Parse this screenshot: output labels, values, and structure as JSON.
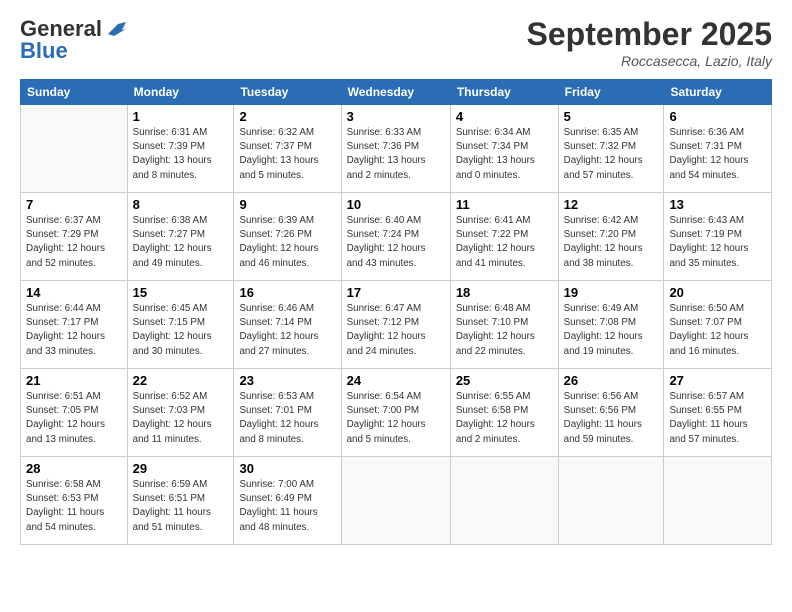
{
  "header": {
    "logo_line1": "General",
    "logo_line2": "Blue",
    "month": "September 2025",
    "location": "Roccasecca, Lazio, Italy"
  },
  "weekdays": [
    "Sunday",
    "Monday",
    "Tuesday",
    "Wednesday",
    "Thursday",
    "Friday",
    "Saturday"
  ],
  "weeks": [
    [
      {
        "day": "",
        "info": ""
      },
      {
        "day": "1",
        "info": "Sunrise: 6:31 AM\nSunset: 7:39 PM\nDaylight: 13 hours\nand 8 minutes."
      },
      {
        "day": "2",
        "info": "Sunrise: 6:32 AM\nSunset: 7:37 PM\nDaylight: 13 hours\nand 5 minutes."
      },
      {
        "day": "3",
        "info": "Sunrise: 6:33 AM\nSunset: 7:36 PM\nDaylight: 13 hours\nand 2 minutes."
      },
      {
        "day": "4",
        "info": "Sunrise: 6:34 AM\nSunset: 7:34 PM\nDaylight: 13 hours\nand 0 minutes."
      },
      {
        "day": "5",
        "info": "Sunrise: 6:35 AM\nSunset: 7:32 PM\nDaylight: 12 hours\nand 57 minutes."
      },
      {
        "day": "6",
        "info": "Sunrise: 6:36 AM\nSunset: 7:31 PM\nDaylight: 12 hours\nand 54 minutes."
      }
    ],
    [
      {
        "day": "7",
        "info": "Sunrise: 6:37 AM\nSunset: 7:29 PM\nDaylight: 12 hours\nand 52 minutes."
      },
      {
        "day": "8",
        "info": "Sunrise: 6:38 AM\nSunset: 7:27 PM\nDaylight: 12 hours\nand 49 minutes."
      },
      {
        "day": "9",
        "info": "Sunrise: 6:39 AM\nSunset: 7:26 PM\nDaylight: 12 hours\nand 46 minutes."
      },
      {
        "day": "10",
        "info": "Sunrise: 6:40 AM\nSunset: 7:24 PM\nDaylight: 12 hours\nand 43 minutes."
      },
      {
        "day": "11",
        "info": "Sunrise: 6:41 AM\nSunset: 7:22 PM\nDaylight: 12 hours\nand 41 minutes."
      },
      {
        "day": "12",
        "info": "Sunrise: 6:42 AM\nSunset: 7:20 PM\nDaylight: 12 hours\nand 38 minutes."
      },
      {
        "day": "13",
        "info": "Sunrise: 6:43 AM\nSunset: 7:19 PM\nDaylight: 12 hours\nand 35 minutes."
      }
    ],
    [
      {
        "day": "14",
        "info": "Sunrise: 6:44 AM\nSunset: 7:17 PM\nDaylight: 12 hours\nand 33 minutes."
      },
      {
        "day": "15",
        "info": "Sunrise: 6:45 AM\nSunset: 7:15 PM\nDaylight: 12 hours\nand 30 minutes."
      },
      {
        "day": "16",
        "info": "Sunrise: 6:46 AM\nSunset: 7:14 PM\nDaylight: 12 hours\nand 27 minutes."
      },
      {
        "day": "17",
        "info": "Sunrise: 6:47 AM\nSunset: 7:12 PM\nDaylight: 12 hours\nand 24 minutes."
      },
      {
        "day": "18",
        "info": "Sunrise: 6:48 AM\nSunset: 7:10 PM\nDaylight: 12 hours\nand 22 minutes."
      },
      {
        "day": "19",
        "info": "Sunrise: 6:49 AM\nSunset: 7:08 PM\nDaylight: 12 hours\nand 19 minutes."
      },
      {
        "day": "20",
        "info": "Sunrise: 6:50 AM\nSunset: 7:07 PM\nDaylight: 12 hours\nand 16 minutes."
      }
    ],
    [
      {
        "day": "21",
        "info": "Sunrise: 6:51 AM\nSunset: 7:05 PM\nDaylight: 12 hours\nand 13 minutes."
      },
      {
        "day": "22",
        "info": "Sunrise: 6:52 AM\nSunset: 7:03 PM\nDaylight: 12 hours\nand 11 minutes."
      },
      {
        "day": "23",
        "info": "Sunrise: 6:53 AM\nSunset: 7:01 PM\nDaylight: 12 hours\nand 8 minutes."
      },
      {
        "day": "24",
        "info": "Sunrise: 6:54 AM\nSunset: 7:00 PM\nDaylight: 12 hours\nand 5 minutes."
      },
      {
        "day": "25",
        "info": "Sunrise: 6:55 AM\nSunset: 6:58 PM\nDaylight: 12 hours\nand 2 minutes."
      },
      {
        "day": "26",
        "info": "Sunrise: 6:56 AM\nSunset: 6:56 PM\nDaylight: 11 hours\nand 59 minutes."
      },
      {
        "day": "27",
        "info": "Sunrise: 6:57 AM\nSunset: 6:55 PM\nDaylight: 11 hours\nand 57 minutes."
      }
    ],
    [
      {
        "day": "28",
        "info": "Sunrise: 6:58 AM\nSunset: 6:53 PM\nDaylight: 11 hours\nand 54 minutes."
      },
      {
        "day": "29",
        "info": "Sunrise: 6:59 AM\nSunset: 6:51 PM\nDaylight: 11 hours\nand 51 minutes."
      },
      {
        "day": "30",
        "info": "Sunrise: 7:00 AM\nSunset: 6:49 PM\nDaylight: 11 hours\nand 48 minutes."
      },
      {
        "day": "",
        "info": ""
      },
      {
        "day": "",
        "info": ""
      },
      {
        "day": "",
        "info": ""
      },
      {
        "day": "",
        "info": ""
      }
    ]
  ]
}
